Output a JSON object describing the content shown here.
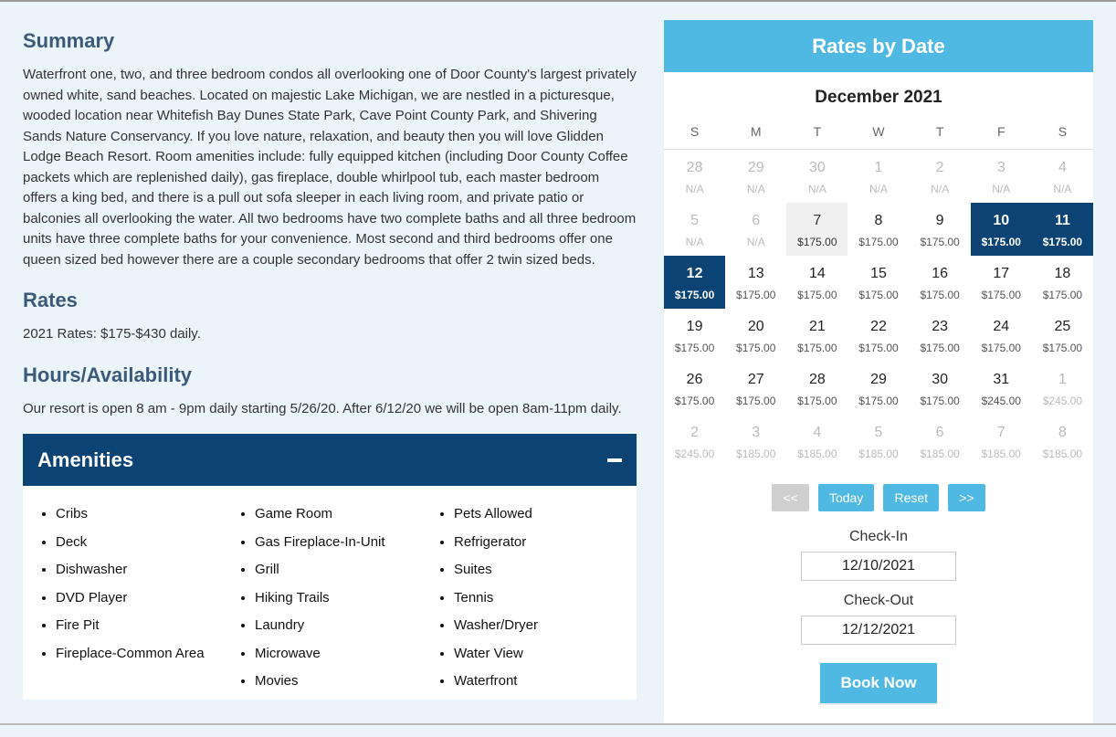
{
  "summary": {
    "heading": "Summary",
    "text": "Waterfront one, two, and three bedroom condos all overlooking one of Door County's largest privately owned white, sand beaches. Located on majestic Lake Michigan, we are nestled in a picturesque, wooded location near Whitefish Bay Dunes State Park, Cave Point County Park, and Shivering Sands Nature Conservancy. If you love nature, relaxation, and beauty then you will love Glidden Lodge Beach Resort. Room amenities include: fully equipped kitchen (including Door County Coffee packets which are replenished daily), gas fireplace, double whirlpool tub, each master bedroom offers a king bed, and there is a pull out sofa sleeper in each living room, and private patio or balconies all overlooking the water. All two bedrooms have two complete baths and all three bedroom units have three complete baths for your convenience. Most second and third bedrooms offer one queen sized bed however there are a couple secondary bedrooms that offer 2 twin sized beds."
  },
  "rates": {
    "heading": "Rates",
    "text": "2021 Rates: $175-$430 daily."
  },
  "hours": {
    "heading": "Hours/Availability",
    "text": "Our resort is open 8 am - 9pm daily starting 5/26/20. After 6/12/20 we will be open 8am-11pm daily."
  },
  "amenities": {
    "heading": "Amenities",
    "col1": [
      "Cribs",
      "Deck",
      "Dishwasher",
      "DVD Player",
      "Fire Pit",
      "Fireplace-Common Area"
    ],
    "col2": [
      "Game Room",
      "Gas Fireplace-In-Unit",
      "Grill",
      "Hiking Trails",
      "Laundry",
      "Microwave",
      "Movies"
    ],
    "col3": [
      "Pets Allowed",
      "Refrigerator",
      "Suites",
      "Tennis",
      "Washer/Dryer",
      "Water View",
      "Waterfront"
    ]
  },
  "rates_panel": {
    "header": "Rates by Date",
    "month": "December 2021",
    "dow": [
      "S",
      "M",
      "T",
      "W",
      "T",
      "F",
      "S"
    ],
    "weeks": [
      [
        {
          "day": "28",
          "price": "N/A",
          "state": "muted"
        },
        {
          "day": "29",
          "price": "N/A",
          "state": "muted"
        },
        {
          "day": "30",
          "price": "N/A",
          "state": "muted"
        },
        {
          "day": "1",
          "price": "N/A",
          "state": "muted"
        },
        {
          "day": "2",
          "price": "N/A",
          "state": "muted"
        },
        {
          "day": "3",
          "price": "N/A",
          "state": "muted"
        },
        {
          "day": "4",
          "price": "N/A",
          "state": "muted"
        }
      ],
      [
        {
          "day": "5",
          "price": "N/A",
          "state": "muted"
        },
        {
          "day": "6",
          "price": "N/A",
          "state": "muted"
        },
        {
          "day": "7",
          "price": "$175.00",
          "state": "hover"
        },
        {
          "day": "8",
          "price": "$175.00",
          "state": "avail"
        },
        {
          "day": "9",
          "price": "$175.00",
          "state": "avail"
        },
        {
          "day": "10",
          "price": "$175.00",
          "state": "selected active-bold"
        },
        {
          "day": "11",
          "price": "$175.00",
          "state": "selected active-bold"
        }
      ],
      [
        {
          "day": "12",
          "price": "$175.00",
          "state": "selected active-bold"
        },
        {
          "day": "13",
          "price": "$175.00",
          "state": "avail"
        },
        {
          "day": "14",
          "price": "$175.00",
          "state": "avail"
        },
        {
          "day": "15",
          "price": "$175.00",
          "state": "avail"
        },
        {
          "day": "16",
          "price": "$175.00",
          "state": "avail"
        },
        {
          "day": "17",
          "price": "$175.00",
          "state": "avail"
        },
        {
          "day": "18",
          "price": "$175.00",
          "state": "avail"
        }
      ],
      [
        {
          "day": "19",
          "price": "$175.00",
          "state": "avail"
        },
        {
          "day": "20",
          "price": "$175.00",
          "state": "avail"
        },
        {
          "day": "21",
          "price": "$175.00",
          "state": "avail"
        },
        {
          "day": "22",
          "price": "$175.00",
          "state": "avail"
        },
        {
          "day": "23",
          "price": "$175.00",
          "state": "avail"
        },
        {
          "day": "24",
          "price": "$175.00",
          "state": "avail"
        },
        {
          "day": "25",
          "price": "$175.00",
          "state": "avail"
        }
      ],
      [
        {
          "day": "26",
          "price": "$175.00",
          "state": "avail"
        },
        {
          "day": "27",
          "price": "$175.00",
          "state": "avail"
        },
        {
          "day": "28",
          "price": "$175.00",
          "state": "avail"
        },
        {
          "day": "29",
          "price": "$175.00",
          "state": "avail"
        },
        {
          "day": "30",
          "price": "$175.00",
          "state": "avail"
        },
        {
          "day": "31",
          "price": "$245.00",
          "state": "avail"
        },
        {
          "day": "1",
          "price": "$245.00",
          "state": "muted"
        }
      ],
      [
        {
          "day": "2",
          "price": "$245.00",
          "state": "muted"
        },
        {
          "day": "3",
          "price": "$185.00",
          "state": "muted"
        },
        {
          "day": "4",
          "price": "$185.00",
          "state": "muted"
        },
        {
          "day": "5",
          "price": "$185.00",
          "state": "muted"
        },
        {
          "day": "6",
          "price": "$185.00",
          "state": "muted"
        },
        {
          "day": "7",
          "price": "$185.00",
          "state": "muted"
        },
        {
          "day": "8",
          "price": "$185.00",
          "state": "muted"
        }
      ]
    ],
    "buttons": {
      "prev": "<<",
      "today": "Today",
      "reset": "Reset",
      "next": ">>"
    },
    "checkin_label": "Check-In",
    "checkin_value": "12/10/2021",
    "checkout_label": "Check-Out",
    "checkout_value": "12/12/2021",
    "book": "Book Now"
  }
}
